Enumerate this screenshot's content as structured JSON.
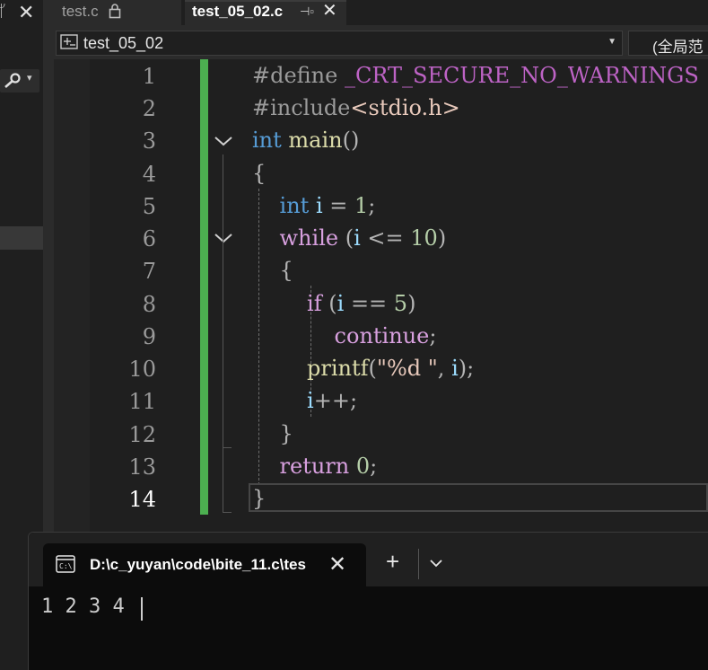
{
  "left_panel": {
    "pin_icon": "pin-icon",
    "close_icon": "close-icon",
    "search_icon": "search-icon"
  },
  "tabs": [
    {
      "label": "test.c",
      "active": false,
      "icon": "lock-icon"
    },
    {
      "label": "test_05_02.c",
      "active": true,
      "icon": "pin-icon"
    }
  ],
  "navbar": {
    "project": "test_05_02",
    "scope": "(全局范"
  },
  "editor": {
    "line_numbers": [
      "1",
      "2",
      "3",
      "4",
      "5",
      "6",
      "7",
      "8",
      "9",
      "10",
      "11",
      "12",
      "13",
      "14"
    ],
    "current_line": "14",
    "change_bar_color": "#4caf50"
  },
  "terminal": {
    "tab_title": "D:\\c_yuyan\\code\\bite_11.c\\tes",
    "output": "1 2 3 4"
  }
}
